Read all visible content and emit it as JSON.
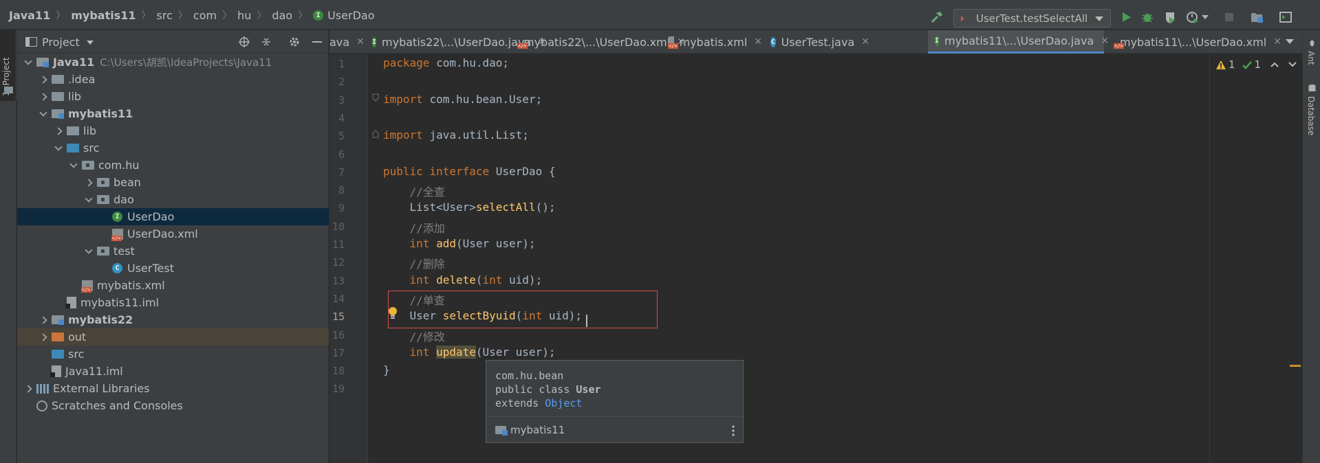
{
  "breadcrumb": [
    "Java11",
    "mybatis11",
    "src",
    "com",
    "hu",
    "dao",
    "UserDao"
  ],
  "run_config": "UserTest.testSelectAll",
  "left_tool_window": "1: Project",
  "right_tool_windows": [
    "Ant",
    "Database"
  ],
  "project_panel": {
    "title": "Project",
    "tree": [
      {
        "label": "Java11",
        "path": "C:\\Users\\胡凯\\IdeaProjects\\Java11",
        "icon": "module-folder-icon"
      },
      {
        "label": ".idea",
        "icon": "folder-icon"
      },
      {
        "label": "lib",
        "icon": "folder-icon"
      },
      {
        "label": "mybatis11",
        "icon": "module-folder-icon"
      },
      {
        "label": "lib",
        "icon": "folder-icon"
      },
      {
        "label": "src",
        "icon": "source-folder-icon"
      },
      {
        "label": "com.hu",
        "icon": "package-icon"
      },
      {
        "label": "bean",
        "icon": "package-icon"
      },
      {
        "label": "dao",
        "icon": "package-icon"
      },
      {
        "label": "UserDao",
        "icon": "interface-icon"
      },
      {
        "label": "UserDao.xml",
        "icon": "xml-file-icon"
      },
      {
        "label": "test",
        "icon": "package-icon"
      },
      {
        "label": "UserTest",
        "icon": "class-icon"
      },
      {
        "label": "mybatis.xml",
        "icon": "xml-file-icon"
      },
      {
        "label": "mybatis11.iml",
        "icon": "iml-file-icon"
      },
      {
        "label": "mybatis22",
        "icon": "module-folder-icon"
      },
      {
        "label": "out",
        "icon": "excluded-folder-icon"
      },
      {
        "label": "src",
        "icon": "source-folder-icon"
      },
      {
        "label": "Java11.iml",
        "icon": "iml-file-icon"
      },
      {
        "label": "External Libraries",
        "icon": "library-icon"
      },
      {
        "label": "Scratches and Consoles",
        "icon": "scratches-icon"
      }
    ]
  },
  "tabs": [
    {
      "label": "ava"
    },
    {
      "label": "mybatis22\\...\\UserDao.java"
    },
    {
      "label": "mybatis22\\...\\UserDao.xml"
    },
    {
      "label": "mybatis.xml"
    },
    {
      "label": "UserTest.java"
    },
    {
      "label": "mybatis11\\...\\UserDao.java",
      "active": true
    },
    {
      "label": "mybatis11\\...\\UserDao.xml"
    }
  ],
  "inspection": {
    "warnings": "1",
    "ok": "1"
  },
  "code": {
    "line_numbers": [
      "1",
      "2",
      "3",
      "4",
      "5",
      "6",
      "7",
      "8",
      "9",
      "10",
      "11",
      "12",
      "13",
      "14",
      "15",
      "16",
      "17",
      "18",
      "19"
    ],
    "current_line": "15",
    "lines": [
      [
        {
          "t": "package ",
          "c": "kw"
        },
        {
          "t": "com.hu.dao;",
          "c": ""
        }
      ],
      [],
      [
        {
          "t": "import ",
          "c": "kw"
        },
        {
          "t": "com.hu.bean.User;",
          "c": ""
        }
      ],
      [],
      [
        {
          "t": "import ",
          "c": "kw"
        },
        {
          "t": "java.util.List;",
          "c": ""
        }
      ],
      [],
      [
        {
          "t": "public interface ",
          "c": "kw"
        },
        {
          "t": "UserDao {",
          "c": ""
        }
      ],
      [
        {
          "t": "    //全查",
          "c": "cm"
        }
      ],
      [
        {
          "t": "    List<User>",
          "c": ""
        },
        {
          "t": "selectAll",
          "c": "fn"
        },
        {
          "t": "();",
          "c": ""
        }
      ],
      [
        {
          "t": "    //添加",
          "c": "cm"
        }
      ],
      [
        {
          "t": "    ",
          "c": ""
        },
        {
          "t": "int ",
          "c": "kw"
        },
        {
          "t": "add",
          "c": "fn"
        },
        {
          "t": "(User user);",
          "c": ""
        }
      ],
      [
        {
          "t": "    //删除",
          "c": "cm"
        }
      ],
      [
        {
          "t": "    ",
          "c": ""
        },
        {
          "t": "int ",
          "c": "kw"
        },
        {
          "t": "delete",
          "c": "fn"
        },
        {
          "t": "(",
          "c": ""
        },
        {
          "t": "int ",
          "c": "kw"
        },
        {
          "t": "uid);",
          "c": ""
        }
      ],
      [
        {
          "t": "    //单查",
          "c": "cm"
        }
      ],
      [
        {
          "t": "    User ",
          "c": ""
        },
        {
          "t": "selectByuid",
          "c": "fn"
        },
        {
          "t": "(",
          "c": ""
        },
        {
          "t": "int ",
          "c": "kw"
        },
        {
          "t": "uid);",
          "c": ""
        }
      ],
      [
        {
          "t": "    //修改",
          "c": "cm"
        }
      ],
      [
        {
          "t": "    ",
          "c": ""
        },
        {
          "t": "int ",
          "c": "kw"
        },
        {
          "t": "update",
          "c": "fn hl"
        },
        {
          "t": "(User user);",
          "c": ""
        }
      ],
      [
        {
          "t": "}",
          "c": ""
        }
      ],
      []
    ]
  },
  "doc_popup": {
    "line1": "com.hu.bean",
    "line2_prefix": "public class ",
    "line2_name": "User",
    "line3_prefix": "extends ",
    "line3_link": "Object",
    "module": "mybatis11"
  },
  "colors": {
    "keyword": "#cc7832",
    "function": "#ffc66d",
    "comment": "#808080",
    "selection": "#0d293e",
    "error_box": "#d64d4d"
  }
}
